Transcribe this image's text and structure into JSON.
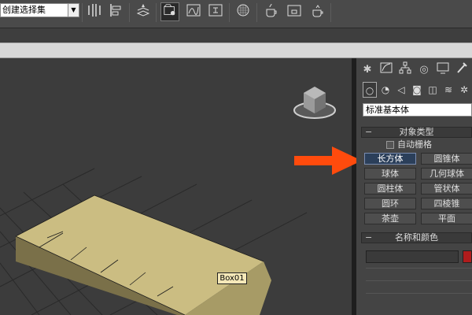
{
  "toolbar": {
    "named_selection": "创建选择集",
    "icons": [
      "mirror-icon",
      "align-icon",
      "layer-icon",
      "scene-explorer-icon",
      "curve-editor-icon",
      "schematic-icon",
      "material-editor-icon",
      "render-setup-icon",
      "render-frame-icon",
      "render-icon"
    ]
  },
  "viewport": {
    "object_label": "Box01",
    "object_color": "#c9bb80"
  },
  "command_panel": {
    "primitive_type": "标准基本体",
    "rollout_object_type": "对象类型",
    "autogrid_label": "自动栅格",
    "buttons": [
      {
        "label": "长方体",
        "selected": true
      },
      {
        "label": "圆锥体",
        "selected": false
      },
      {
        "label": "球体",
        "selected": false
      },
      {
        "label": "几何球体",
        "selected": false
      },
      {
        "label": "圆柱体",
        "selected": false
      },
      {
        "label": "管状体",
        "selected": false
      },
      {
        "label": "圆环",
        "selected": false
      },
      {
        "label": "四棱锥",
        "selected": false
      },
      {
        "label": "茶壶",
        "selected": false
      },
      {
        "label": "平面",
        "selected": false
      }
    ],
    "rollout_name_color": "名称和颜色",
    "swatch_color": "#b01c1c"
  },
  "annotation": {
    "arrow_color": "#ff4b0d"
  }
}
